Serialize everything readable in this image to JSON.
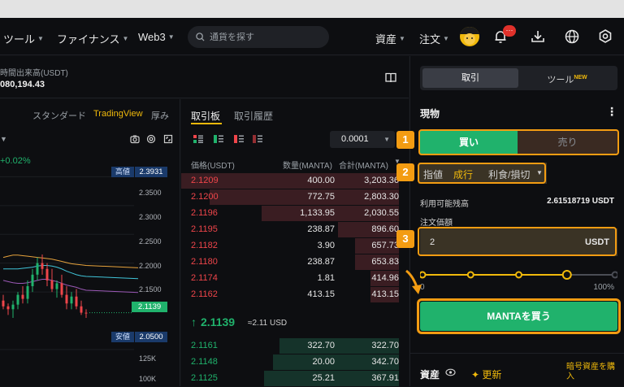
{
  "nav": {
    "items": [
      "ツール",
      "ファイナンス",
      "Web3"
    ],
    "search_placeholder": "通貨を探す",
    "assets": "資産",
    "orders": "注文",
    "notification_count": "···"
  },
  "stats": {
    "label": "時間出来高(USDT)",
    "value": "080,194.43"
  },
  "chart": {
    "tabs": [
      "スタンダード",
      "TradingView",
      "厚み"
    ],
    "active_tab": "TradingView",
    "change_label": "+0.02%",
    "high_label": "高値",
    "high_value": "2.3931",
    "low_label": "安値",
    "low_value": "2.0500",
    "current_price_tag": "2.1139",
    "price_ticks": [
      "2.3500",
      "2.3000",
      "2.2500",
      "2.2000",
      "2.1500"
    ],
    "volume_ticks": [
      "125K",
      "100K"
    ]
  },
  "chart_data": {
    "type": "candlestick",
    "title": "",
    "y_ticks": [
      2.35,
      2.3,
      2.25,
      2.2,
      2.15,
      2.05
    ],
    "ylim": [
      2.04,
      2.4
    ],
    "candles": [
      {
        "o": 2.135,
        "h": 2.145,
        "l": 2.12,
        "c": 2.125
      },
      {
        "o": 2.125,
        "h": 2.13,
        "l": 2.11,
        "c": 2.12
      },
      {
        "o": 2.12,
        "h": 2.135,
        "l": 2.105,
        "c": 2.128
      },
      {
        "o": 2.128,
        "h": 2.15,
        "l": 2.12,
        "c": 2.145
      },
      {
        "o": 2.145,
        "h": 2.16,
        "l": 2.13,
        "c": 2.138
      },
      {
        "o": 2.138,
        "h": 2.17,
        "l": 2.13,
        "c": 2.16
      },
      {
        "o": 2.16,
        "h": 2.19,
        "l": 2.15,
        "c": 2.18
      },
      {
        "o": 2.18,
        "h": 2.21,
        "l": 2.17,
        "c": 2.2
      },
      {
        "o": 2.2,
        "h": 2.215,
        "l": 2.18,
        "c": 2.19
      },
      {
        "o": 2.19,
        "h": 2.2,
        "l": 2.16,
        "c": 2.17
      },
      {
        "o": 2.17,
        "h": 2.19,
        "l": 2.15,
        "c": 2.155
      },
      {
        "o": 2.155,
        "h": 2.17,
        "l": 2.14,
        "c": 2.165
      },
      {
        "o": 2.165,
        "h": 2.18,
        "l": 2.14,
        "c": 2.145
      },
      {
        "o": 2.145,
        "h": 2.16,
        "l": 2.12,
        "c": 2.13
      },
      {
        "o": 2.13,
        "h": 2.15,
        "l": 2.12,
        "c": 2.142
      },
      {
        "o": 2.142,
        "h": 2.155,
        "l": 2.12,
        "c": 2.125
      },
      {
        "o": 2.125,
        "h": 2.135,
        "l": 2.11,
        "c": 2.114
      },
      {
        "o": 2.114,
        "h": 2.12,
        "l": 2.105,
        "c": 2.1139
      }
    ],
    "ma_lines": [
      {
        "color": "#e6a23c",
        "values": [
          2.21,
          2.212,
          2.214,
          2.214,
          2.213,
          2.212,
          2.211,
          2.21,
          2.209,
          2.208,
          2.207,
          2.205,
          2.203,
          2.201,
          2.199,
          2.198,
          2.197,
          2.196
        ]
      },
      {
        "color": "#40c4d8",
        "values": [
          2.19,
          2.19,
          2.19,
          2.19,
          2.191,
          2.192,
          2.193,
          2.195,
          2.196,
          2.196,
          2.195,
          2.193,
          2.19,
          2.186,
          2.183,
          2.18,
          2.178,
          2.177
        ]
      },
      {
        "color": "#9b59b6",
        "values": [
          2.17,
          2.168,
          2.166,
          2.165,
          2.165,
          2.166,
          2.168,
          2.17,
          2.172,
          2.172,
          2.17,
          2.168,
          2.165,
          2.162,
          2.16,
          2.158,
          2.155,
          2.153
        ]
      }
    ]
  },
  "orderbook": {
    "tabs": [
      "取引板",
      "取引履歴"
    ],
    "precision": "0.0001",
    "headers": [
      "価格(USDT)",
      "数量(MANTA)",
      "合計(MANTA)"
    ],
    "asks": [
      {
        "price": "2.1209",
        "qty": "400.00",
        "total": "3,203.36",
        "depth": 1.0
      },
      {
        "price": "2.1200",
        "qty": "772.75",
        "total": "2,803.30",
        "depth": 0.87
      },
      {
        "price": "2.1196",
        "qty": "1,133.95",
        "total": "2,030.55",
        "depth": 0.63
      },
      {
        "price": "2.1195",
        "qty": "238.87",
        "total": "896.60",
        "depth": 0.28
      },
      {
        "price": "2.1182",
        "qty": "3.90",
        "total": "657.73",
        "depth": 0.2
      },
      {
        "price": "2.1180",
        "qty": "238.87",
        "total": "653.83",
        "depth": 0.2
      },
      {
        "price": "2.1174",
        "qty": "1.81",
        "total": "414.96",
        "depth": 0.13
      },
      {
        "price": "2.1162",
        "qty": "413.15",
        "total": "413.15",
        "depth": 0.13
      }
    ],
    "last_price": "2.1139",
    "last_usd": "≈2.11 USD",
    "bids": [
      {
        "price": "2.1161",
        "qty": "322.70",
        "total": "322.70",
        "depth": 0.55
      },
      {
        "price": "2.1148",
        "qty": "20.00",
        "total": "342.70",
        "depth": 0.58
      },
      {
        "price": "2.1125",
        "qty": "25.21",
        "total": "367.91",
        "depth": 0.62
      }
    ]
  },
  "trade": {
    "tabs": [
      "取引",
      "ツール"
    ],
    "tool_badge": "NEW",
    "section_title": "現物",
    "buy": "買い",
    "sell": "売り",
    "order_types": [
      "指値",
      "成行",
      "利食/損切"
    ],
    "active_order_type": "成行",
    "available_label": "利用可能残高",
    "available_value": "2.61518719 USDT",
    "price_label": "注文価額",
    "amount_value": "2",
    "amount_unit": "USDT",
    "slider_min": "0",
    "slider_max": "100%",
    "slider_level": 0.75,
    "buy_button": "MANTAを買う",
    "assets_label": "資産",
    "refresh_label": "更新",
    "buy_crypto_label": "暗号資産を購入",
    "steps": [
      "1",
      "2",
      "3"
    ]
  },
  "colors": {
    "green": "#20b26c",
    "red": "#ef454a",
    "accent": "#f0b90b",
    "annotation": "#f39c12"
  }
}
